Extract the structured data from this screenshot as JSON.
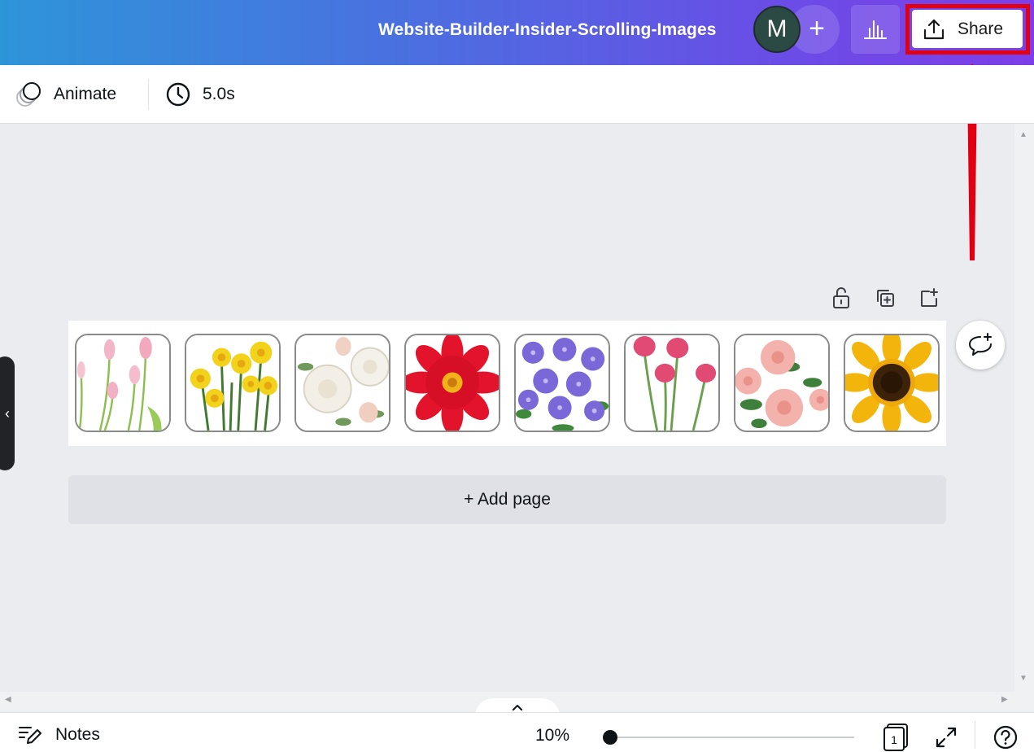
{
  "header": {
    "title": "Website-Builder-Insider-Scrolling-Images",
    "avatar_initial": "M",
    "add_collaborator_glyph": "+",
    "insights_icon": "bar-chart-icon",
    "share_label": "Share",
    "share_icon": "upload-icon",
    "highlight_color": "#e00012"
  },
  "toolbar": {
    "animate_label": "Animate",
    "duration_label": "5.0s"
  },
  "page_actions": {
    "icons": [
      "unlock-icon",
      "duplicate-page-icon",
      "add-page-icon"
    ]
  },
  "page": {
    "tiles": [
      {
        "name": "tulips",
        "color": "#f3b6c8"
      },
      {
        "name": "daffodils",
        "color": "#f2d21a"
      },
      {
        "name": "white-roses",
        "color": "#f3efe6"
      },
      {
        "name": "red-dahlia",
        "color": "#e3132b"
      },
      {
        "name": "bellflowers",
        "color": "#7b68d8"
      },
      {
        "name": "pink-tulips",
        "color": "#e04a73"
      },
      {
        "name": "pink-roses",
        "color": "#f4b2ac"
      },
      {
        "name": "sunflower",
        "color": "#f3b50c"
      }
    ]
  },
  "canvas": {
    "add_page_label": "+ Add page",
    "left_handle_glyph": "‹",
    "collapse_glyph": "^"
  },
  "footer": {
    "notes_label": "Notes",
    "zoom_value": "10%",
    "zoom_fraction": 0.0,
    "page_count": "1"
  }
}
